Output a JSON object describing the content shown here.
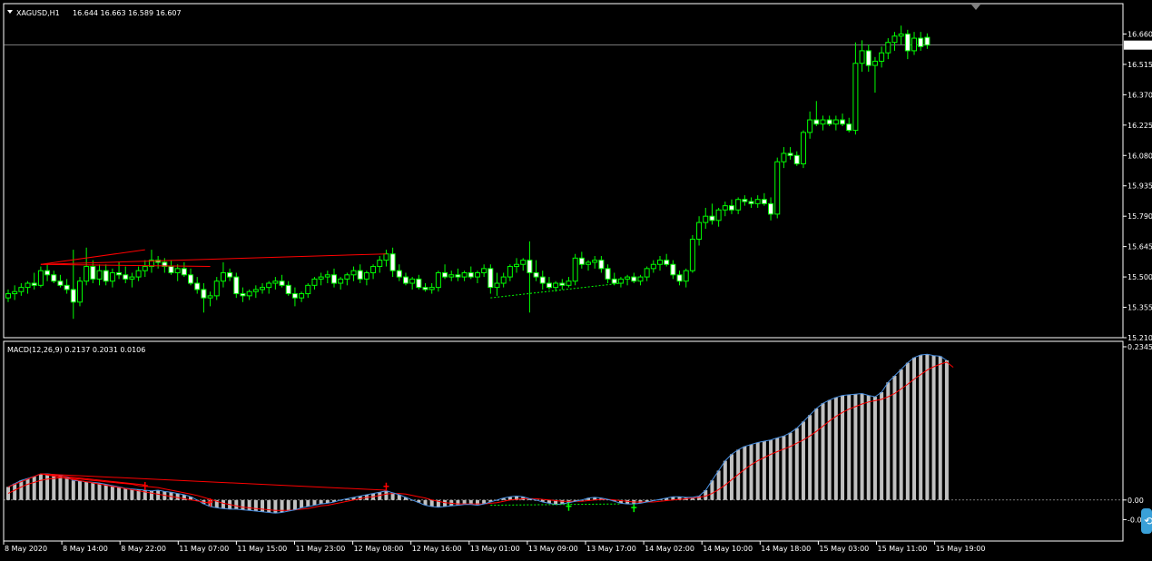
{
  "header": {
    "symbol": "XAGUSD,H1",
    "ohlc": "16.644 16.663 16.589 16.607"
  },
  "indicator": {
    "label": "MACD(12,26,9) 0.2137 0.2031 0.0106"
  },
  "colors": {
    "background": "#000000",
    "frame": "#ffffff",
    "grid_dash": "#c0c0c0",
    "bull_body": "#000000",
    "bull_outline": "#00ff00",
    "bear_body": "#ffffff",
    "wick": "#00ff00",
    "trendline": "#ff0000",
    "support_line": "#00ff00",
    "macd_line": "#4a90e2",
    "signal_line": "#ff0000",
    "histogram": "#c0c0c0",
    "price_line": "#c0c0c0",
    "bid_label_bg": "#ffffff",
    "bid_label_fg": "#000000"
  },
  "chart_data": [
    {
      "type": "candlestick",
      "y_ticks": [
        "16.660",
        "16.515",
        "16.370",
        "16.225",
        "16.080",
        "15.935",
        "15.790",
        "15.645",
        "15.500",
        "15.355",
        "15.210"
      ],
      "ylim": [
        15.21,
        16.805
      ],
      "current_price": "16.607",
      "candles": [
        [
          15.4,
          15.44,
          15.38,
          15.42
        ],
        [
          15.42,
          15.46,
          15.39,
          15.43
        ],
        [
          15.43,
          15.47,
          15.41,
          15.45
        ],
        [
          15.45,
          15.48,
          15.42,
          15.47
        ],
        [
          15.47,
          15.52,
          15.44,
          15.46
        ],
        [
          15.46,
          15.55,
          15.45,
          15.53
        ],
        [
          15.53,
          15.56,
          15.48,
          15.51
        ],
        [
          15.51,
          15.53,
          15.47,
          15.48
        ],
        [
          15.48,
          15.51,
          15.45,
          15.46
        ],
        [
          15.46,
          15.49,
          15.42,
          15.44
        ],
        [
          15.44,
          15.63,
          15.3,
          15.38
        ],
        [
          15.38,
          15.5,
          15.36,
          15.48
        ],
        [
          15.48,
          15.64,
          15.46,
          15.55
        ],
        [
          15.55,
          15.58,
          15.47,
          15.49
        ],
        [
          15.49,
          15.56,
          15.46,
          15.53
        ],
        [
          15.53,
          15.56,
          15.46,
          15.48
        ],
        [
          15.48,
          15.54,
          15.45,
          15.52
        ],
        [
          15.52,
          15.57,
          15.49,
          15.51
        ],
        [
          15.51,
          15.55,
          15.47,
          15.49
        ],
        [
          15.49,
          15.52,
          15.45,
          15.5
        ],
        [
          15.5,
          15.55,
          15.48,
          15.53
        ],
        [
          15.53,
          15.58,
          15.5,
          15.55
        ],
        [
          15.55,
          15.63,
          15.52,
          15.58
        ],
        [
          15.58,
          15.6,
          15.54,
          15.57
        ],
        [
          15.57,
          15.59,
          15.52,
          15.55
        ],
        [
          15.55,
          15.58,
          15.51,
          15.52
        ],
        [
          15.52,
          15.56,
          15.48,
          15.54
        ],
        [
          15.54,
          15.57,
          15.5,
          15.51
        ],
        [
          15.51,
          15.54,
          15.46,
          15.47
        ],
        [
          15.47,
          15.5,
          15.42,
          15.44
        ],
        [
          15.44,
          15.47,
          15.33,
          15.4
        ],
        [
          15.4,
          15.43,
          15.36,
          15.41
        ],
        [
          15.41,
          15.5,
          15.39,
          15.48
        ],
        [
          15.48,
          15.57,
          15.45,
          15.52
        ],
        [
          15.52,
          15.54,
          15.48,
          15.5
        ],
        [
          15.5,
          15.52,
          15.4,
          15.42
        ],
        [
          15.42,
          15.45,
          15.38,
          15.41
        ],
        [
          15.41,
          15.44,
          15.39,
          15.43
        ],
        [
          15.43,
          15.46,
          15.4,
          15.44
        ],
        [
          15.44,
          15.47,
          15.42,
          15.45
        ],
        [
          15.45,
          15.48,
          15.42,
          15.47
        ],
        [
          15.47,
          15.5,
          15.44,
          15.48
        ],
        [
          15.48,
          15.51,
          15.45,
          15.46
        ],
        [
          15.46,
          15.48,
          15.41,
          15.42
        ],
        [
          15.42,
          15.45,
          15.36,
          15.4
        ],
        [
          15.4,
          15.43,
          15.38,
          15.42
        ],
        [
          15.42,
          15.47,
          15.4,
          15.46
        ],
        [
          15.46,
          15.5,
          15.44,
          15.49
        ],
        [
          15.49,
          15.52,
          15.46,
          15.5
        ],
        [
          15.5,
          15.53,
          15.47,
          15.51
        ],
        [
          15.51,
          15.54,
          15.45,
          15.47
        ],
        [
          15.47,
          15.5,
          15.44,
          15.49
        ],
        [
          15.49,
          15.52,
          15.46,
          15.51
        ],
        [
          15.51,
          15.55,
          15.48,
          15.53
        ],
        [
          15.53,
          15.56,
          15.47,
          15.49
        ],
        [
          15.49,
          15.53,
          15.46,
          15.52
        ],
        [
          15.52,
          15.56,
          15.49,
          15.55
        ],
        [
          15.55,
          15.6,
          15.52,
          15.58
        ],
        [
          15.58,
          15.63,
          15.55,
          15.61
        ],
        [
          15.61,
          15.64,
          15.5,
          15.53
        ],
        [
          15.53,
          15.56,
          15.48,
          15.5
        ],
        [
          15.5,
          15.52,
          15.46,
          15.47
        ],
        [
          15.47,
          15.5,
          15.44,
          15.49
        ],
        [
          15.49,
          15.51,
          15.44,
          15.45
        ],
        [
          15.45,
          15.47,
          15.43,
          15.44
        ],
        [
          15.44,
          15.47,
          15.42,
          15.45
        ],
        [
          15.45,
          15.53,
          15.43,
          15.52
        ],
        [
          15.52,
          15.56,
          15.49,
          15.5
        ],
        [
          15.5,
          15.53,
          15.48,
          15.51
        ],
        [
          15.51,
          15.54,
          15.48,
          15.5
        ],
        [
          15.5,
          15.53,
          15.48,
          15.52
        ],
        [
          15.52,
          15.55,
          15.49,
          15.5
        ],
        [
          15.5,
          15.53,
          15.47,
          15.52
        ],
        [
          15.52,
          15.56,
          15.5,
          15.54
        ],
        [
          15.54,
          15.56,
          15.42,
          15.45
        ],
        [
          15.45,
          15.52,
          15.41,
          15.47
        ],
        [
          15.47,
          15.52,
          15.45,
          15.5
        ],
        [
          15.5,
          15.56,
          15.48,
          15.55
        ],
        [
          15.55,
          15.59,
          15.52,
          15.56
        ],
        [
          15.56,
          15.59,
          15.53,
          15.58
        ],
        [
          15.58,
          15.67,
          15.33,
          15.52
        ],
        [
          15.52,
          15.58,
          15.48,
          15.5
        ],
        [
          15.5,
          15.53,
          15.44,
          15.47
        ],
        [
          15.47,
          15.5,
          15.44,
          15.45
        ],
        [
          15.45,
          15.48,
          15.43,
          15.47
        ],
        [
          15.47,
          15.49,
          15.44,
          15.46
        ],
        [
          15.46,
          15.5,
          15.45,
          15.48
        ],
        [
          15.48,
          15.61,
          15.46,
          15.59
        ],
        [
          15.59,
          15.62,
          15.54,
          15.56
        ],
        [
          15.56,
          15.58,
          15.53,
          15.57
        ],
        [
          15.57,
          15.6,
          15.54,
          15.58
        ],
        [
          15.58,
          15.6,
          15.52,
          15.54
        ],
        [
          15.54,
          15.56,
          15.47,
          15.49
        ],
        [
          15.49,
          15.52,
          15.46,
          15.47
        ],
        [
          15.47,
          15.5,
          15.45,
          15.49
        ],
        [
          15.49,
          15.51,
          15.46,
          15.5
        ],
        [
          15.5,
          15.52,
          15.47,
          15.48
        ],
        [
          15.48,
          15.51,
          15.46,
          15.5
        ],
        [
          15.5,
          15.55,
          15.48,
          15.54
        ],
        [
          15.54,
          15.58,
          15.52,
          15.56
        ],
        [
          15.56,
          15.6,
          15.53,
          15.58
        ],
        [
          15.58,
          15.61,
          15.55,
          15.56
        ],
        [
          15.56,
          15.58,
          15.49,
          15.51
        ],
        [
          15.51,
          15.53,
          15.46,
          15.48
        ],
        [
          15.48,
          15.54,
          15.45,
          15.53
        ],
        [
          15.53,
          15.7,
          15.52,
          15.68
        ],
        [
          15.68,
          15.79,
          15.65,
          15.76
        ],
        [
          15.76,
          15.83,
          15.73,
          15.79
        ],
        [
          15.79,
          15.85,
          15.75,
          15.77
        ],
        [
          15.77,
          15.83,
          15.74,
          15.82
        ],
        [
          15.82,
          15.86,
          15.79,
          15.84
        ],
        [
          15.84,
          15.87,
          15.8,
          15.82
        ],
        [
          15.82,
          15.88,
          15.8,
          15.87
        ],
        [
          15.87,
          15.89,
          15.84,
          15.86
        ],
        [
          15.86,
          15.88,
          15.83,
          15.85
        ],
        [
          15.85,
          15.89,
          15.83,
          15.87
        ],
        [
          15.87,
          15.9,
          15.84,
          15.85
        ],
        [
          15.85,
          15.88,
          15.77,
          15.8
        ],
        [
          15.8,
          16.07,
          15.78,
          16.05
        ],
        [
          16.05,
          16.12,
          16.02,
          16.09
        ],
        [
          16.09,
          16.12,
          16.06,
          16.08
        ],
        [
          16.08,
          16.1,
          16.03,
          16.04
        ],
        [
          16.04,
          16.2,
          16.02,
          16.19
        ],
        [
          16.19,
          16.29,
          16.16,
          16.25
        ],
        [
          16.25,
          16.34,
          16.22,
          16.23
        ],
        [
          16.23,
          16.27,
          16.2,
          16.25
        ],
        [
          16.25,
          16.27,
          16.22,
          16.23
        ],
        [
          16.23,
          16.27,
          16.2,
          16.25
        ],
        [
          16.25,
          16.28,
          16.22,
          16.23
        ],
        [
          16.23,
          16.26,
          16.19,
          16.2
        ],
        [
          16.2,
          16.62,
          16.18,
          16.52
        ],
        [
          16.52,
          16.63,
          16.48,
          16.58
        ],
        [
          16.58,
          16.61,
          16.48,
          16.51
        ],
        [
          16.51,
          16.55,
          16.38,
          16.53
        ],
        [
          16.53,
          16.6,
          16.5,
          16.57
        ],
        [
          16.57,
          16.64,
          16.54,
          16.62
        ],
        [
          16.62,
          16.67,
          16.58,
          16.65
        ],
        [
          16.65,
          16.7,
          16.61,
          16.66
        ],
        [
          16.66,
          16.68,
          16.54,
          16.58
        ],
        [
          16.58,
          16.67,
          16.56,
          16.64
        ],
        [
          16.64,
          16.67,
          16.58,
          16.6
        ],
        [
          16.644,
          16.663,
          16.589,
          16.607
        ]
      ],
      "trendlines": [
        {
          "from": [
            5,
            15.56
          ],
          "to": [
            21,
            15.63
          ]
        },
        {
          "from": [
            5,
            15.56
          ],
          "to": [
            58,
            15.61
          ]
        },
        {
          "from": [
            5,
            15.56
          ],
          "to": [
            31,
            15.55
          ]
        }
      ],
      "support_line": {
        "from": [
          74,
          15.4
        ],
        "to": [
          94,
          15.47
        ]
      }
    },
    {
      "type": "macd",
      "title": "MACD(12,26,9) 0.2137 0.2031 0.0106",
      "y_ticks": [
        "0.2345",
        "0.00",
        "-0.0"
      ],
      "ylim": [
        -0.06,
        0.2345
      ],
      "macd": [
        0.02,
        0.025,
        0.03,
        0.033,
        0.036,
        0.04,
        0.04,
        0.039,
        0.038,
        0.035,
        0.03,
        0.029,
        0.028,
        0.027,
        0.026,
        0.024,
        0.022,
        0.02,
        0.018,
        0.017,
        0.016,
        0.015,
        0.014,
        0.015,
        0.013,
        0.012,
        0.01,
        0.008,
        0.005,
        0.0,
        -0.006,
        -0.01,
        -0.012,
        -0.013,
        -0.014,
        -0.014,
        -0.015,
        -0.016,
        -0.017,
        -0.018,
        -0.019,
        -0.02,
        -0.019,
        -0.017,
        -0.015,
        -0.012,
        -0.01,
        -0.008,
        -0.006,
        -0.005,
        -0.003,
        0.0,
        0.002,
        0.004,
        0.006,
        0.008,
        0.01,
        0.012,
        0.014,
        0.011,
        0.008,
        0.004,
        0.0,
        -0.004,
        -0.008,
        -0.01,
        -0.011,
        -0.01,
        -0.009,
        -0.008,
        -0.007,
        -0.007,
        -0.008,
        -0.006,
        -0.003,
        0.0,
        0.003,
        0.005,
        0.006,
        0.005,
        0.002,
        0.0,
        -0.003,
        -0.005,
        -0.007,
        -0.006,
        -0.004,
        -0.002,
        0.0,
        0.003,
        0.004,
        0.003,
        0.001,
        -0.002,
        -0.005,
        -0.006,
        -0.006,
        -0.005,
        -0.003,
        -0.001,
        0.001,
        0.003,
        0.005,
        0.005,
        0.004,
        0.004,
        0.006,
        0.015,
        0.03,
        0.045,
        0.06,
        0.07,
        0.077,
        0.082,
        0.085,
        0.088,
        0.09,
        0.092,
        0.095,
        0.098,
        0.103,
        0.11,
        0.12,
        0.13,
        0.14,
        0.148,
        0.153,
        0.157,
        0.16,
        0.161,
        0.162,
        0.163,
        0.16,
        0.158,
        0.165,
        0.18,
        0.19,
        0.2,
        0.21,
        0.218,
        0.222,
        0.223,
        0.221,
        0.22,
        0.2137
      ],
      "signal": [
        0.01,
        0.015,
        0.02,
        0.024,
        0.027,
        0.03,
        0.032,
        0.033,
        0.034,
        0.034,
        0.033,
        0.032,
        0.031,
        0.03,
        0.029,
        0.028,
        0.027,
        0.026,
        0.025,
        0.024,
        0.022,
        0.021,
        0.02,
        0.019,
        0.017,
        0.015,
        0.013,
        0.011,
        0.009,
        0.007,
        0.004,
        0.001,
        -0.002,
        -0.005,
        -0.007,
        -0.009,
        -0.011,
        -0.012,
        -0.013,
        -0.014,
        -0.015,
        -0.016,
        -0.016,
        -0.016,
        -0.015,
        -0.014,
        -0.013,
        -0.011,
        -0.009,
        -0.008,
        -0.006,
        -0.004,
        -0.002,
        0.0,
        0.002,
        0.004,
        0.005,
        0.007,
        0.009,
        0.01,
        0.01,
        0.009,
        0.007,
        0.005,
        0.003,
        0.0,
        -0.002,
        -0.004,
        -0.005,
        -0.006,
        -0.006,
        -0.006,
        -0.006,
        -0.006,
        -0.005,
        -0.004,
        -0.002,
        0.0,
        0.001,
        0.002,
        0.002,
        0.002,
        0.001,
        0.0,
        -0.001,
        -0.002,
        -0.002,
        -0.002,
        -0.002,
        -0.001,
        0.0,
        0.001,
        0.001,
        0.0,
        -0.001,
        -0.002,
        -0.003,
        -0.003,
        -0.003,
        -0.003,
        -0.002,
        -0.001,
        0.0,
        0.001,
        0.002,
        0.003,
        0.004,
        0.006,
        0.01,
        0.016,
        0.023,
        0.031,
        0.039,
        0.047,
        0.054,
        0.06,
        0.065,
        0.07,
        0.074,
        0.078,
        0.082,
        0.087,
        0.092,
        0.098,
        0.105,
        0.113,
        0.121,
        0.128,
        0.134,
        0.139,
        0.143,
        0.147,
        0.15,
        0.152,
        0.154,
        0.158,
        0.163,
        0.17,
        0.177,
        0.185,
        0.192,
        0.199,
        0.204,
        0.208,
        0.211,
        0.2031
      ],
      "trendlines": [
        {
          "from": [
            5,
            0.04
          ],
          "to": [
            21,
            0.023
          ]
        },
        {
          "from": [
            5,
            0.04
          ],
          "to": [
            31,
            -0.005
          ]
        },
        {
          "from": [
            5,
            0.04
          ],
          "to": [
            58,
            0.015
          ]
        },
        {
          "from": [
            0,
            0.02
          ],
          "to": [
            5,
            0.04
          ]
        }
      ],
      "support_line": {
        "from": [
          74,
          -0.008
        ],
        "to": [
          94,
          -0.006
        ]
      },
      "arrows_down": [
        21,
        31,
        58
      ],
      "arrows_up": [
        86,
        96
      ]
    }
  ],
  "x_labels": [
    "8 May 2020",
    "8 May 14:00",
    "8 May 22:00",
    "11 May 07:00",
    "11 May 15:00",
    "11 May 23:00",
    "12 May 08:00",
    "12 May 16:00",
    "13 May 01:00",
    "13 May 09:00",
    "13 May 17:00",
    "14 May 02:00",
    "14 May 10:00",
    "14 May 18:00",
    "15 May 03:00",
    "15 May 11:00",
    "15 May 19:00"
  ]
}
